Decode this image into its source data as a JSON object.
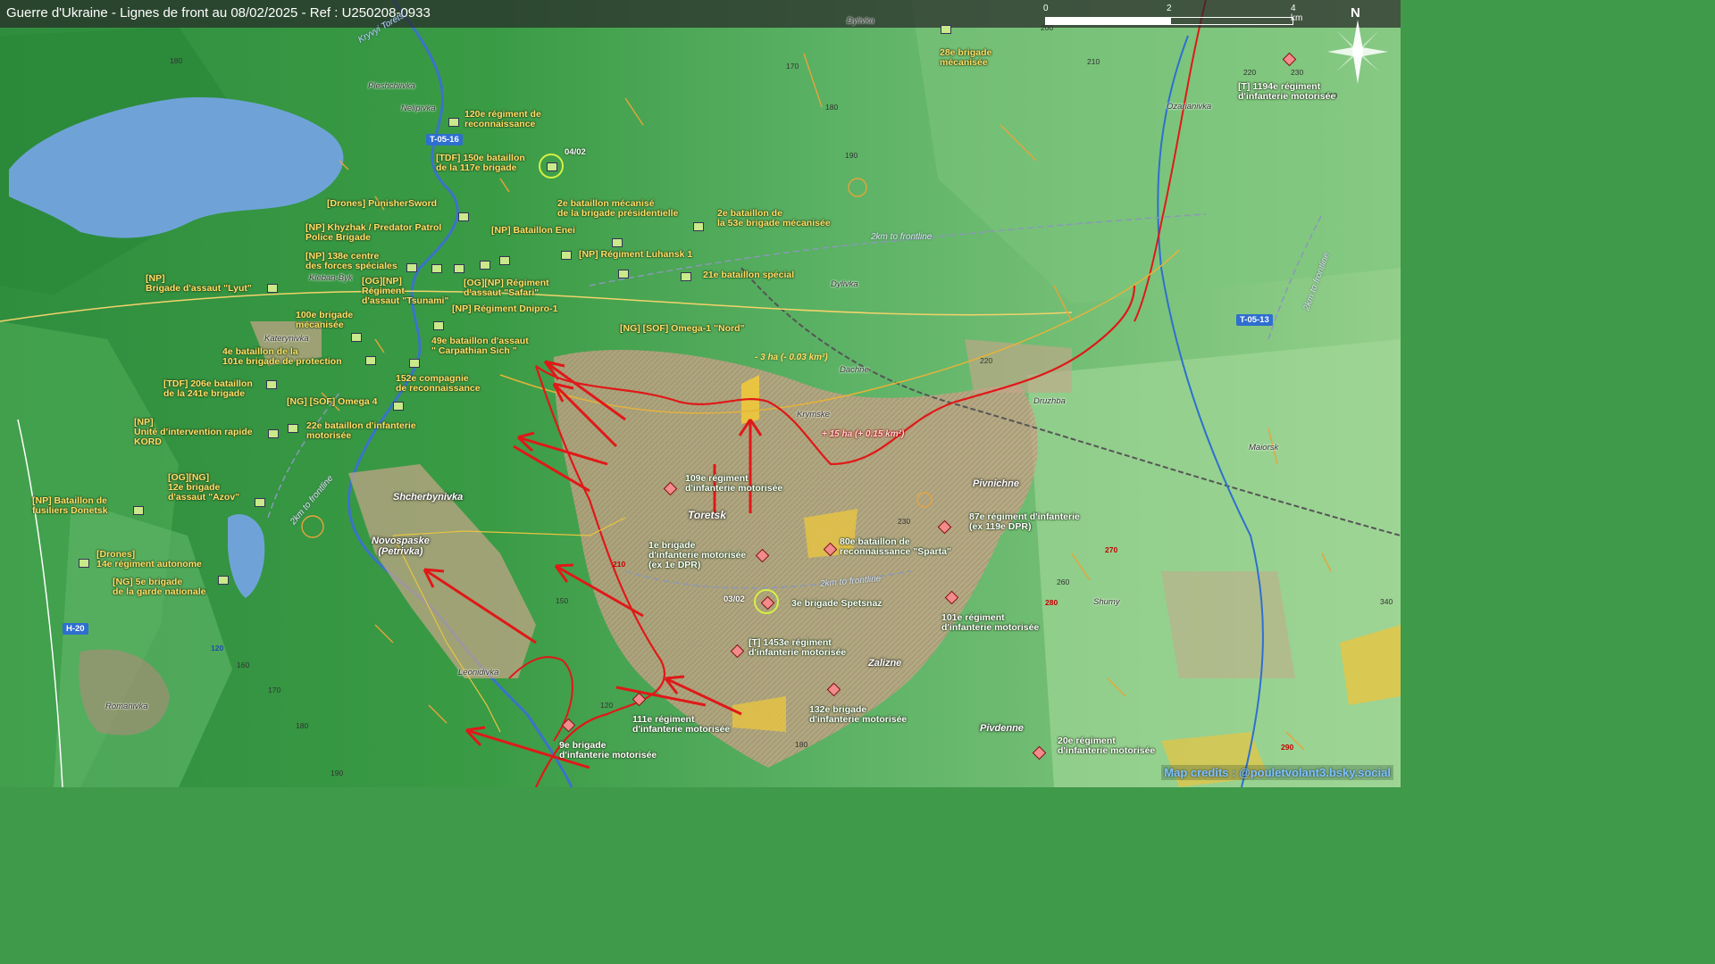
{
  "header": {
    "title": "Guerre d'Ukraine - Lignes de front au 08/02/2025 - Ref : U250208-0933",
    "scale_ticks": [
      "0",
      "2",
      "4 km"
    ],
    "north_label": "N"
  },
  "credits": "Map credits : @pouletvolant3.bsky.social",
  "colors": {
    "front_line": "#e01818",
    "ua_unit_fill": "#c9e98a",
    "ru_unit_fill": "#f28b8b",
    "water": "#6fa3d8",
    "urban": "#c9a58a"
  },
  "roads": [
    "T-05-16",
    "T-05-13",
    "H-20"
  ],
  "distance_notes": [
    "2km to frontline",
    "2km to frontline",
    "2km to frontline",
    "2km to frontline"
  ],
  "front_changes": {
    "north_loss": "- 3 ha (- 0.03 km²)",
    "east_gain": "+ 15 ha (+ 0.15 km²)"
  },
  "dates": [
    "04/02",
    "03/02"
  ],
  "rivers": [
    "Kryvyi Torets"
  ],
  "towns": {
    "toretsk": "Toretsk",
    "shcherbynivka": "Shcherbynivka",
    "novospaske": "Novospaske\n(Petrivka)",
    "pivnichne": "Pivnichne",
    "zalizne": "Zalizne",
    "pivdenne": "Pivdenne"
  },
  "villages": [
    "Pleshchiivka",
    "Nelipivka",
    "Dylivka",
    "Ozarianivka",
    "Kleban-Byk",
    "Katerynivka",
    "Dylivka",
    "Dachne",
    "Krymske",
    "Druzhba",
    "Maiorsk",
    "Shumy",
    "Leonidivka",
    "Romanivka"
  ],
  "contours": [
    "180",
    "170",
    "180",
    "190",
    "210",
    "220",
    "230",
    "240",
    "220",
    "230",
    "210",
    "150",
    "120",
    "160",
    "170",
    "180",
    "190",
    "180",
    "260",
    "270",
    "280",
    "290",
    "340",
    "200",
    "120"
  ],
  "ua_units": [
    "28e brigade\nmécanisée",
    "120e régiment de\nreconnaissance",
    "[TDF] 150e bataillon\nde la 117e brigade",
    "[Drones] PunisherSword",
    "2e bataillon mécanisé\nde la brigade présidentielle",
    "2e bataillon de\nla 53e brigade mécanisée",
    "[NP] Khyzhak / Predator Patrol\nPolice Brigade",
    "[NP] Bataillon Enei",
    "[NP] 138e centre\ndes forces spéciales",
    "[NP] Régiment Luhansk 1",
    "[NP]\nBrigade d'assaut \"Lyut\"",
    "[OG][NP]\nRégiment\nd'assaut \"Tsunami\"",
    "[OG][NP] Régiment\nd'assaut \"Safari\"",
    "21e bataillon spécial",
    "[NP] Régiment Dnipro-1",
    "100e brigade\nmécanisée",
    "[NG] [SOF] Omega-1 \"Nord\"",
    "49e bataillon d'assaut\n\" Carpathian Sich \"",
    "4e bataillon de la\n101e brigade de protection",
    "[TDF] 206e bataillon\nde la 241e brigade",
    "152e compagnie\nde reconnaissance",
    "[NG] [SOF] Omega 4",
    "[NP]\nUnité d'intervention rapide\nKORD",
    "22e bataillon d'infanterie\nmotorisée",
    "[OG][NG]\n12e brigade\nd'assaut \"Azov\"",
    "[NP] Bataillon de\nfusiliers Donetsk",
    "[Drones]\n14e régiment autonome",
    "[NG] 5e brigade\nde la garde nationale"
  ],
  "ru_units": [
    "[T] 1194e régiment\nd'infanterie motorisée",
    "109e régiment\nd'infanterie motorisée",
    "1e brigade\nd'infanterie motorisée\n(ex 1e DPR)",
    "80e bataillon de\nreconnaissance \"Sparta\"",
    "87e régiment d'infanterie\n(ex 119e DPR)",
    "3e brigade Spetsnaz",
    "[T] 1453e régiment\nd'infanterie motorisée",
    "101e régiment\nd'infanterie motorisée",
    "132e brigade\nd'infanterie motorisée",
    "111e régiment\nd'infanterie motorisée",
    "9e brigade\nd'infanterie motorisée",
    "20e régiment\nd'infanterie motorisée"
  ]
}
